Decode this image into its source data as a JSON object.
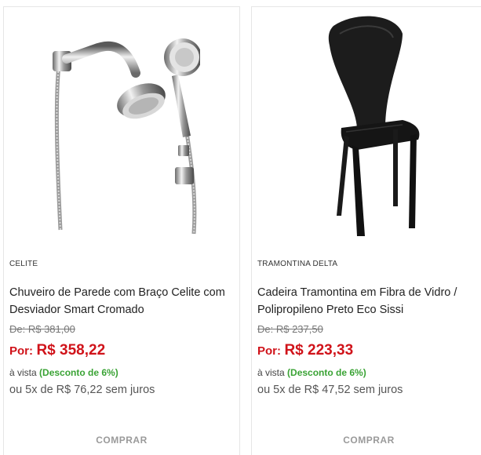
{
  "products": [
    {
      "brand": "CELITE",
      "name": "Chuveiro de Parede com Braço Celite com Desviador Smart Cromado",
      "old_price": "De: R$ 381,00",
      "price_prefix": "Por:",
      "price": "R$ 358,22",
      "cash_prefix": "à vista",
      "discount": "(Desconto de 6%)",
      "installments": "ou 5x de R$ 76,22 sem juros",
      "buy_label": "COMPRAR",
      "image_icon": "shower-image"
    },
    {
      "brand": "TRAMONTINA DELTA",
      "name": "Cadeira Tramontina em Fibra de Vidro / Polipropileno Preto Eco Sissi",
      "old_price": "De: R$ 237,50",
      "price_prefix": "Por:",
      "price": "R$ 223,33",
      "cash_prefix": "à vista",
      "discount": "(Desconto de 6%)",
      "installments": "ou 5x de R$ 47,52 sem juros",
      "buy_label": "COMPRAR",
      "image_icon": "chair-image"
    }
  ],
  "colors": {
    "price": "#d0131a",
    "discount": "#3aa335",
    "buy": "#9a9a9a"
  }
}
